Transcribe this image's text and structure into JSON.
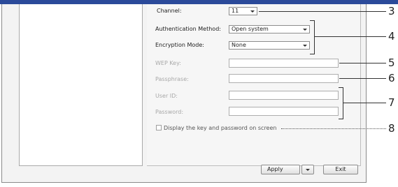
{
  "form": {
    "channel_label": "Channel:",
    "channel_value": "11",
    "auth_label": "Authentication Method:",
    "auth_value": "Open system",
    "enc_label": "Encryption Mode:",
    "enc_value": "None",
    "wep_label": "WEP Key:",
    "passphrase_label": "Passphrase:",
    "userid_label": "User ID:",
    "password_label": "Password:",
    "display_label": "Display the key and password on screen"
  },
  "buttons": {
    "apply": "Apply",
    "exit": "Exit"
  },
  "callouts": {
    "c3": "3",
    "c4": "4",
    "c5": "5",
    "c6": "6",
    "c7": "7",
    "c8": "8"
  },
  "colors": {
    "title_bar": "#2b4a9a",
    "window_bg": "#f3f3f3"
  }
}
